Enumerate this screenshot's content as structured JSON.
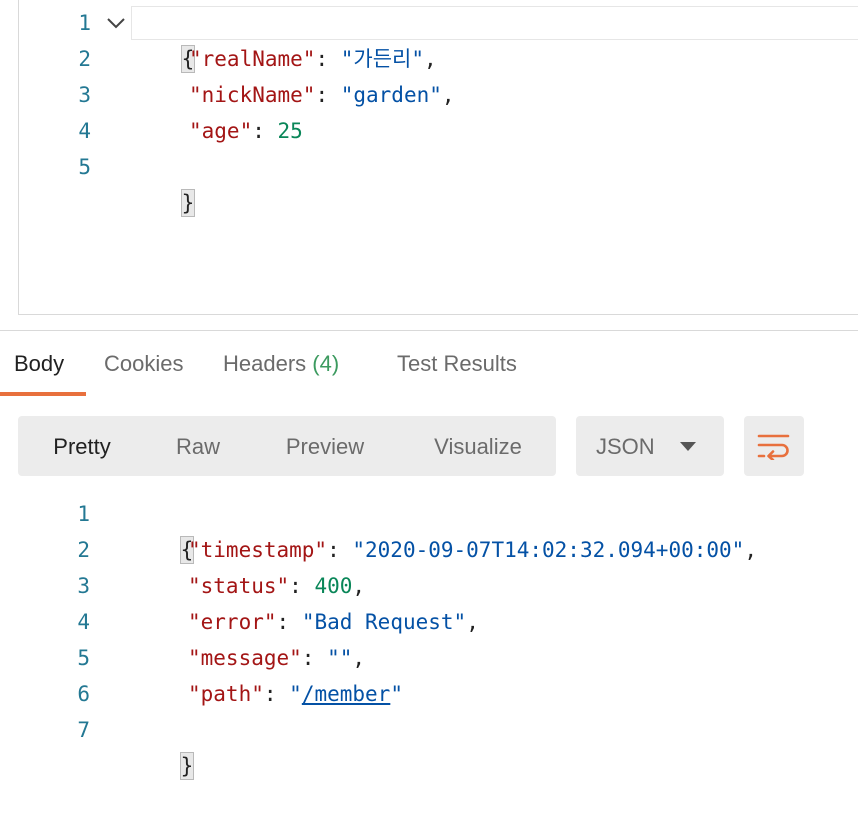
{
  "request_body": {
    "line_numbers": [
      "1",
      "2",
      "3",
      "4",
      "5"
    ],
    "open_brace": "{",
    "close_brace": "}",
    "lines": [
      {
        "key": "\"realName\"",
        "sep": ": ",
        "value": "\"가든리\"",
        "end": ","
      },
      {
        "key": "\"nickName\"",
        "sep": ": ",
        "value": "\"garden\"",
        "end": ","
      },
      {
        "key": "\"age\"",
        "sep": ": ",
        "value": "25",
        "end": ""
      }
    ]
  },
  "response_tabs": {
    "body": "Body",
    "cookies": "Cookies",
    "headers": "Headers",
    "headers_count": "(4)",
    "test_results": "Test Results"
  },
  "view_modes": {
    "pretty": "Pretty",
    "raw": "Raw",
    "preview": "Preview",
    "visualize": "Visualize"
  },
  "format_select": {
    "selected": "JSON"
  },
  "wrap_icon": "wrap-lines-icon",
  "accent_color": "#e8703d",
  "response_body": {
    "line_numbers": [
      "1",
      "2",
      "3",
      "4",
      "5",
      "6",
      "7"
    ],
    "open_brace": "{",
    "close_brace": "}",
    "lines": [
      {
        "key": "\"timestamp\"",
        "sep": ": ",
        "value": "\"2020-09-07T14:02:32.094+00:00\"",
        "end": ","
      },
      {
        "key": "\"status\"",
        "sep": ": ",
        "value": "400",
        "end": ","
      },
      {
        "key": "\"error\"",
        "sep": ": ",
        "value": "\"Bad Request\"",
        "end": ","
      },
      {
        "key": "\"message\"",
        "sep": ": ",
        "value": "\"\"",
        "end": ","
      },
      {
        "key": "\"path\"",
        "sep": ": ",
        "value_open": "\"",
        "value_link": "/member",
        "value_close": "\"",
        "end": ""
      }
    ]
  }
}
